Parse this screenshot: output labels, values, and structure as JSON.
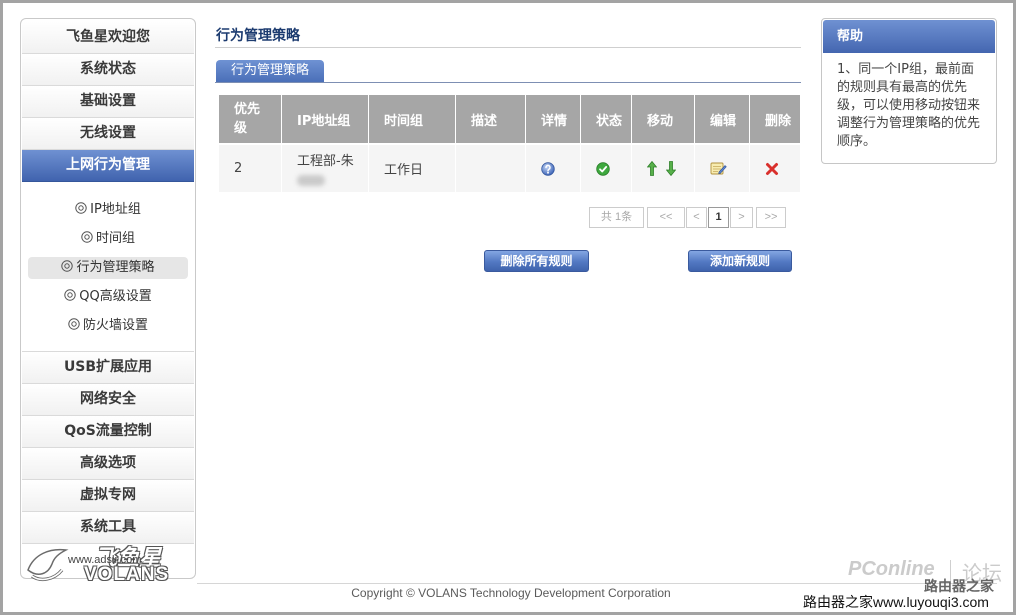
{
  "theme": {
    "accent": "#4a6db5",
    "header_gray": "#a6a6a6",
    "status_ok": "#3ea83e",
    "danger": "#d9302c"
  },
  "sidebar": {
    "top_items": [
      {
        "label": "飞鱼星欢迎您"
      },
      {
        "label": "系统状态"
      },
      {
        "label": "基础设置"
      },
      {
        "label": "无线设置"
      },
      {
        "label": "上网行为管理",
        "active": true
      }
    ],
    "sub_items": [
      {
        "label": "IP地址组",
        "icon": "bullet-circle-icon"
      },
      {
        "label": "时间组",
        "icon": "bullet-circle-icon"
      },
      {
        "label": "行为管理策略",
        "icon": "bullet-circle-icon",
        "selected": true
      },
      {
        "label": "QQ高级设置",
        "icon": "bullet-circle-icon"
      },
      {
        "label": "防火墙设置",
        "icon": "bullet-circle-icon"
      }
    ],
    "bottom_items": [
      {
        "label": "USB扩展应用"
      },
      {
        "label": "网络安全"
      },
      {
        "label": "QoS流量控制"
      },
      {
        "label": "高级选项"
      },
      {
        "label": "虚拟专网"
      },
      {
        "label": "系统工具"
      }
    ],
    "logo": {
      "brand_cn": "飞鱼星",
      "brand_en": "VOLANS",
      "url": "www.adslr.com"
    }
  },
  "main": {
    "title": "行为管理策略",
    "tabs": [
      {
        "label": "行为管理策略",
        "active": true
      }
    ],
    "table": {
      "columns": [
        "优先级",
        "IP地址组",
        "时间组",
        "描述",
        "详情",
        "状态",
        "移动",
        "编辑",
        "删除"
      ],
      "rows": [
        {
          "priority": "2",
          "ip_group": "工程部-朱",
          "time_group": "工作日",
          "description": "",
          "details_icon": "info-icon",
          "status_icon": "enabled-check-icon",
          "move_icons": [
            "move-up-icon",
            "move-down-icon"
          ],
          "edit_icon": "edit-icon",
          "delete_icon": "delete-icon"
        }
      ]
    },
    "pagination": {
      "summary": "共 1条",
      "first": "<<",
      "prev": "<",
      "current": "1",
      "next": ">",
      "last": ">>"
    },
    "actions": {
      "delete_all": "删除所有规则",
      "add_new": "添加新规则"
    }
  },
  "help": {
    "title": "帮助",
    "text": "1、同一个IP组，最前面的规则具有最高的优先级，可以使用移动按钮来调整行为管理策略的优先顺序。"
  },
  "footer": {
    "copyright": "Copyright © VOLANS Technology Development Corporation"
  },
  "watermarks": {
    "pconline": "PConline",
    "forum": "论坛",
    "site_name": "路由器之家",
    "site_banner": "路由器之家www.luyouqi3.com"
  }
}
